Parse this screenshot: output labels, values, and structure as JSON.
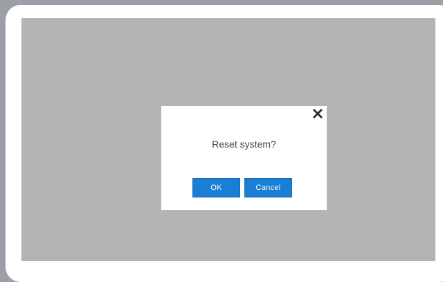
{
  "dialog": {
    "message": "Reset system?",
    "ok_label": "OK",
    "cancel_label": "Cancel",
    "close_icon": "close-icon"
  },
  "colors": {
    "overlay": "#b4b5b3",
    "button": "#1a7fd4",
    "close_icon": "#2e2f3e"
  }
}
